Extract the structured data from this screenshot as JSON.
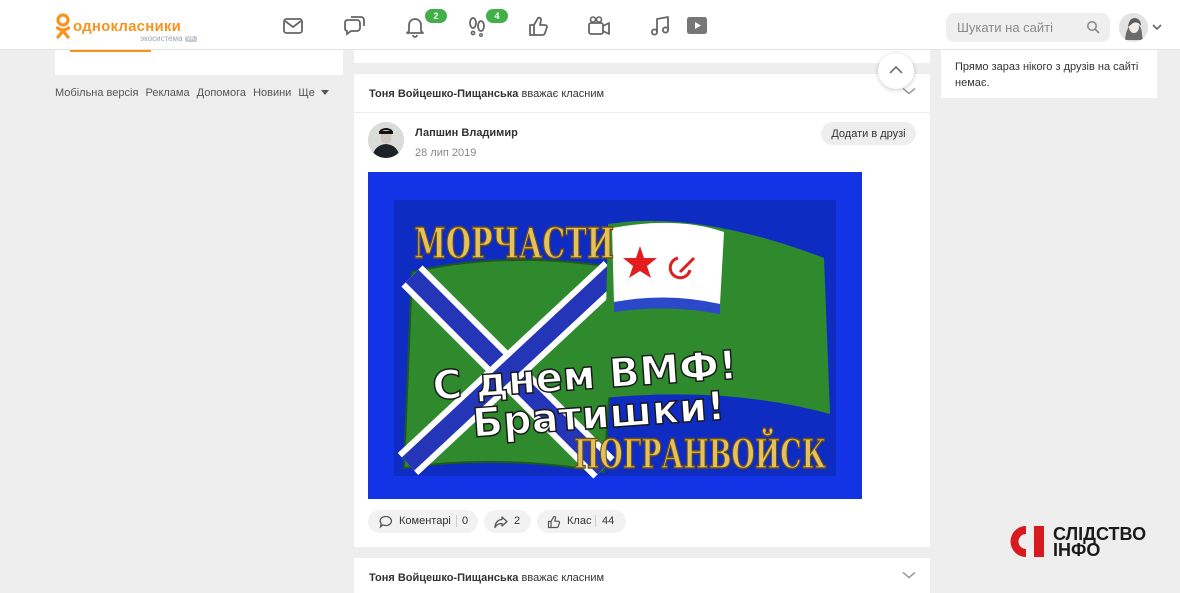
{
  "header": {
    "logo_text": "однокласники",
    "logo_sub": "экосистема",
    "logo_badge": "VK",
    "nav_icons": [
      "messages-icon",
      "discussions-icon",
      "notifications-icon",
      "guests-icon",
      "events-icon",
      "video-calls-icon",
      "music-icon",
      "video-icon"
    ],
    "notifications_count": "2",
    "guests_count": "4",
    "search_placeholder": "Шукати на сайті",
    "accent_color": "#f7931e",
    "badge_color": "#41b04a"
  },
  "left": {
    "footer_links": [
      "Мобільна версія",
      "Реклама",
      "Допомога",
      "Новини",
      "Ще"
    ]
  },
  "feed": {
    "card1": {
      "actor": "Тоня Войцешко-Пищанська",
      "action": "вважає класним",
      "author": "Лапшин Владимир",
      "date": "28 лип 2019",
      "add_friend_label": "Додати в друзі",
      "image": {
        "top_text": "МОРЧАСТИ",
        "greeting_line1": "С днем ВМФ!",
        "greeting_line2": "Братишки!",
        "bottom_text": "ПОГРАНВОЙСК",
        "background_color": "#1233e6"
      },
      "actions": {
        "comments_label": "Коментарі",
        "comments_count": "0",
        "shares_count": "2",
        "likes_label": "Клас",
        "likes_count": "44"
      }
    },
    "card2": {
      "actor": "Тоня Войцешко-Пищанська",
      "action": "вважає класним"
    }
  },
  "right": {
    "friends_online_text": "Прямо зараз нікого з друзів на сайті немає."
  },
  "watermark": {
    "mark": "СІ",
    "line1": "СЛІДСТВО",
    "line2": "ІНФО",
    "color": "#d71920"
  }
}
